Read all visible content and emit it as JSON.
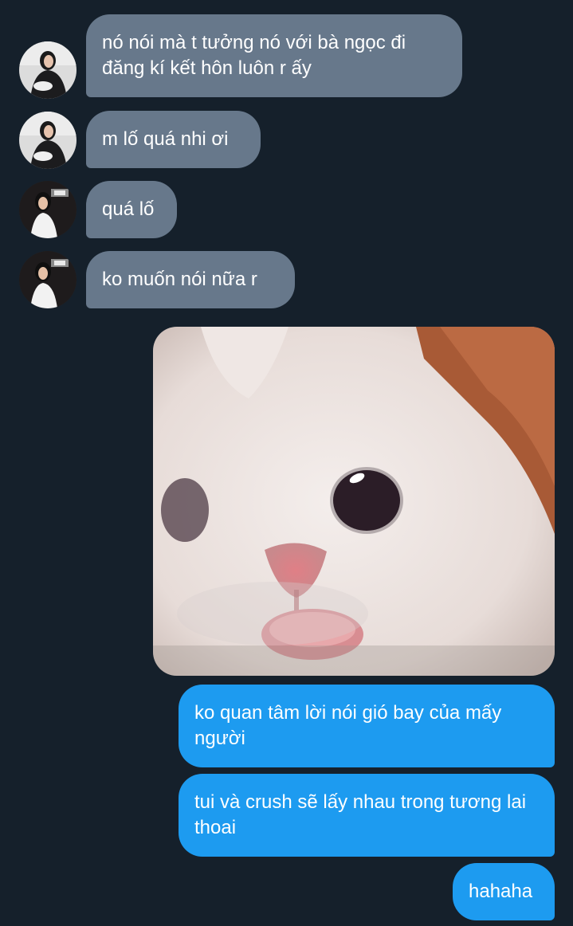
{
  "conversation": {
    "incoming": [
      {
        "text": "nó nói mà t tưởng nó với bà ngọc đi đăng kí kết hôn luôn r ấy",
        "avatar": "avatar-1"
      },
      {
        "text": "m lố quá nhi ơi",
        "avatar": "avatar-1"
      },
      {
        "text": "quá lố",
        "avatar": "avatar-2"
      },
      {
        "text": "ko muốn nói nữa r",
        "avatar": "avatar-2"
      }
    ],
    "image": {
      "icon": "cat-photo"
    },
    "outgoing": [
      {
        "text": "ko quan tâm lời nói gió bay của mấy người"
      },
      {
        "text": "tui và crush sẽ lấy nhau trong tương lai thoai"
      },
      {
        "text": "hahaha"
      }
    ]
  },
  "colors": {
    "background": "#15202b",
    "incoming_bubble": "#67788b",
    "outgoing_bubble": "#1d9bf0"
  }
}
